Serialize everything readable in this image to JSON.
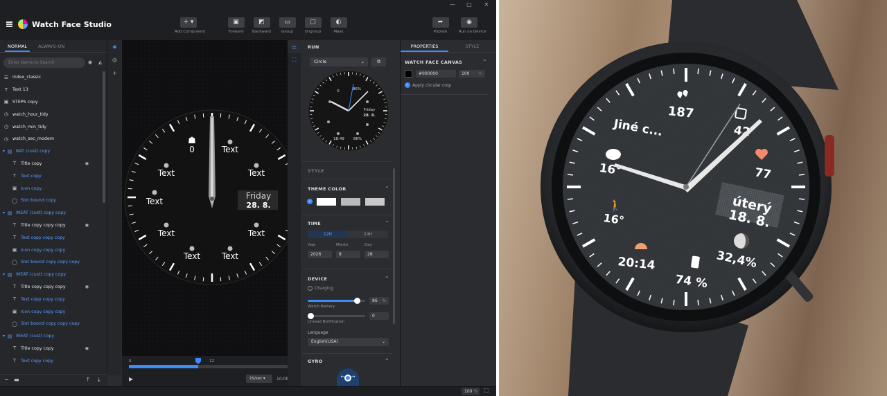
{
  "app": {
    "title": "Watch Face Studio",
    "window_controls": [
      "—",
      "□",
      "✕"
    ]
  },
  "toolbar": {
    "add_component": "Add Component",
    "forward": "Forward",
    "backward": "Backward",
    "group": "Group",
    "ungroup": "Ungroup",
    "mask": "Mask",
    "publish": "Publish",
    "run_on_device": "Run on Device"
  },
  "left": {
    "tabs": [
      "NORMAL",
      "ALWAYS-ON"
    ],
    "search_placeholder": "Enter Name to Search",
    "layers": [
      {
        "label": "index_classic",
        "icon": "list-icon",
        "kind": "item"
      },
      {
        "label": "Text 13",
        "icon": "text-icon",
        "kind": "item"
      },
      {
        "label": "STEPS copy",
        "icon": "image-icon",
        "kind": "item"
      },
      {
        "label": "watch_hour_tidy",
        "icon": "clock-icon",
        "kind": "item"
      },
      {
        "label": "watch_min_tidy",
        "icon": "clock-icon",
        "kind": "item"
      },
      {
        "label": "watch_sec_modern",
        "icon": "clock-icon",
        "kind": "item"
      },
      {
        "label": "BAT (cust) copy",
        "icon": "folder-icon",
        "kind": "grp"
      },
      {
        "label": "Title copy",
        "icon": "text-icon",
        "kind": "child",
        "eye": true
      },
      {
        "label": "Text copy",
        "icon": "text-icon",
        "kind": "sub"
      },
      {
        "label": "Icon copy",
        "icon": "image-icon",
        "kind": "sub"
      },
      {
        "label": "Slot bound copy",
        "icon": "slot-icon",
        "kind": "sub"
      },
      {
        "label": "WEAT (cust) copy copy",
        "icon": "folder-icon",
        "kind": "grp"
      },
      {
        "label": "Title copy copy copy",
        "icon": "text-icon",
        "kind": "child",
        "eye": true
      },
      {
        "label": "Text copy copy copy",
        "icon": "text-icon",
        "kind": "sub"
      },
      {
        "label": "Icon copy copy copy",
        "icon": "image-icon",
        "kind": "sub"
      },
      {
        "label": "Slot bound copy copy copy",
        "icon": "slot-icon",
        "kind": "sub"
      },
      {
        "label": "WEAT (cust) copy copy",
        "icon": "folder-icon",
        "kind": "grp"
      },
      {
        "label": "Title copy copy copy",
        "icon": "text-icon",
        "kind": "child",
        "eye": true
      },
      {
        "label": "Text copy copy copy",
        "icon": "text-icon",
        "kind": "sub"
      },
      {
        "label": "Icon copy copy copy",
        "icon": "image-icon",
        "kind": "sub"
      },
      {
        "label": "Slot bound copy copy copy",
        "icon": "slot-icon",
        "kind": "sub"
      },
      {
        "label": "WEAT (cust) copy",
        "icon": "folder-icon",
        "kind": "grp"
      },
      {
        "label": "Title copy copy",
        "icon": "text-icon",
        "kind": "child",
        "eye": true
      },
      {
        "label": "Text copy copy",
        "icon": "text-icon",
        "kind": "sub"
      }
    ]
  },
  "canvas": {
    "texts": [
      "Text",
      "Text",
      "Text",
      "Text",
      "Text",
      "Text",
      "Text",
      "Text"
    ],
    "steps_value": "0",
    "date_day": "Friday",
    "date_num": "28. 8."
  },
  "timeline": {
    "ticks": [
      "0",
      "12",
      "24"
    ],
    "progress": 0.42,
    "speed": "1S/sec",
    "time": "10:08:32"
  },
  "run": {
    "title": "RUN",
    "shape": "Circle",
    "preview": {
      "steps": "0",
      "battery1": "86%",
      "battery2": "86%",
      "day": "Friday",
      "date": "28. 8.",
      "time": "18:49"
    },
    "style_label": "STYLE",
    "theme_label": "THEME COLOR",
    "theme_colors": [
      "#ffffff",
      "#bbbbbb",
      "#c8c8c8"
    ],
    "time_label": "TIME",
    "time_modes": [
      "12H",
      "24H"
    ],
    "year_label": "Year",
    "month_label": "Month",
    "day_label": "Day",
    "year": "2026",
    "month": "8",
    "day": "28",
    "device_label": "DEVICE",
    "charging_label": "Charging",
    "battery_label": "Watch Battery",
    "battery_value": "86",
    "battery_unit": "%",
    "battery_level": 0.86,
    "unread_label": "Unread Notification",
    "unread_value": "0",
    "language_label": "Language",
    "language": "English(USA)",
    "gyro_label": "GYRO"
  },
  "props": {
    "tabs": [
      "PROPERTIES",
      "STYLE"
    ],
    "section": "WATCH FACE CANVAS",
    "color": "#000000",
    "opacity": "100",
    "opacity_unit": "%",
    "crop_label": "Apply circular crop"
  },
  "status": {
    "zoom": "100",
    "zoom_unit": "%"
  },
  "photo_face": {
    "steps": "187",
    "notif": "42",
    "heart": "77",
    "weather_temp": "16°",
    "label": "Jiné c...",
    "walk_temp": "16°",
    "day": "úterý",
    "date": "18. 8.",
    "sunset": "20:14",
    "moon": "32,4%",
    "battery": "74 %"
  },
  "colors": {
    "accent": "#3b8cff",
    "panel": "#2b2c30",
    "heart": "#f28b6c",
    "sun": "#f0a070"
  }
}
